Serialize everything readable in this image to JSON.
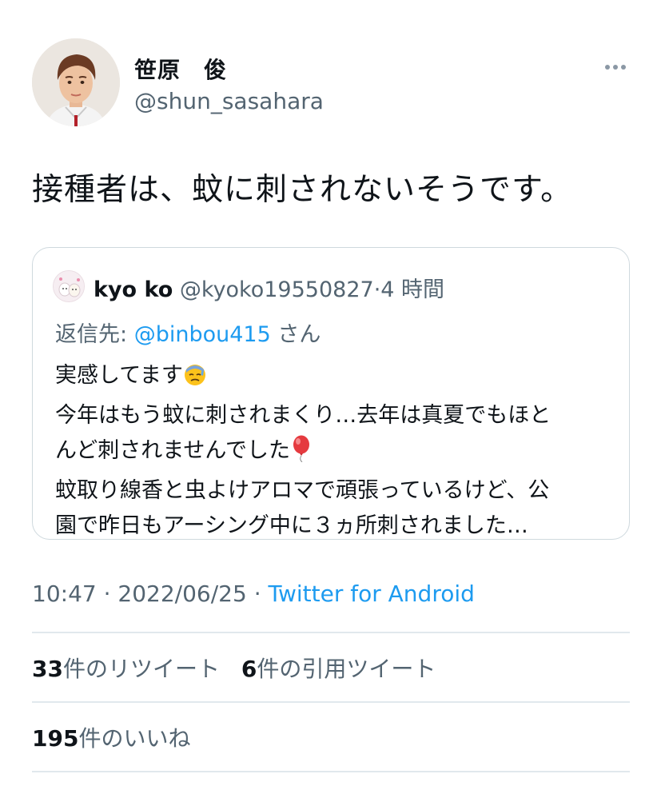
{
  "author": {
    "display_name": "笹原　俊",
    "handle": "@shun_sasahara"
  },
  "tweet": {
    "text": "接種者は、蚊に刺されないそうです。"
  },
  "quoted_tweet": {
    "display_name": "kyo ko",
    "handle": "@kyoko19550827",
    "separator": "·",
    "time": "4 時間",
    "reply_prefix": "返信先: ",
    "reply_to": "@binbou415",
    "reply_suffix": " さん",
    "lines": [
      "実感してます",
      "今年はもう蚊に刺されまくり…去年は真夏でもほと",
      "んど刺されませんでした",
      "蚊取り線香と虫よけアロマで頑張っているけど、公",
      "園で昨日もアーシング中に３ヵ所刺されました…"
    ],
    "emoji": [
      "downcast-sweat-face",
      "balloon"
    ]
  },
  "meta": {
    "time": "10:47",
    "separator1": " · ",
    "date": "2022/06/25",
    "separator2": " · ",
    "source": "Twitter for Android"
  },
  "stats": {
    "retweets_count": "33",
    "retweets_label": "件のリツイート",
    "quotes_count": "6",
    "quotes_label": "件の引用ツイート",
    "likes_count": "195",
    "likes_label": "件のいいね"
  },
  "colors": {
    "link": "#1d9bf0",
    "secondary_text": "#536471",
    "border": "#cfd9de"
  }
}
